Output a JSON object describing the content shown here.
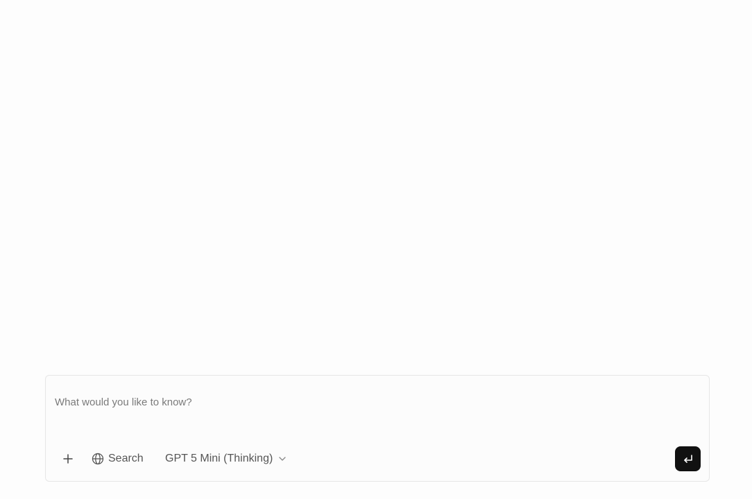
{
  "composer": {
    "input_placeholder": "What would you like to know?",
    "input_value": ""
  },
  "toolbar": {
    "attach_icon": "plus-icon",
    "search_icon": "globe-icon",
    "search_label": "Search",
    "model_label": "GPT 5 Mini (Thinking)",
    "model_dropdown_icon": "chevron-down-icon",
    "send_icon": "enter-return-icon"
  },
  "colors": {
    "background": "#fdfdfd",
    "composer_border": "#e6e6e6",
    "send_button": "#111111",
    "text_muted": "#555555"
  }
}
